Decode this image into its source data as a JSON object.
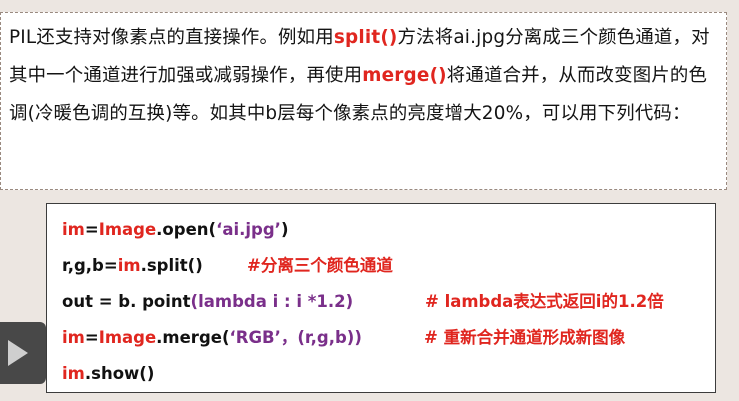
{
  "intro": {
    "text_1": "PIL还支持对像素点的直接操作。例如用",
    "kw_split": "split()",
    "text_2": "方法将ai.jpg分离成三个颜色通道，对其中一个通道进行加强或减弱操作，再使用",
    "kw_merge": "merge()",
    "text_3": "将通道合并，从而改变图片的色调(冷暖色调的互换)等。如其中b层每个像素点的亮度增大20%，可以用下列代码："
  },
  "code": {
    "line1": {
      "var": "im",
      "eq": "=",
      "obj": "Image",
      "method": ".open(",
      "arg": "‘ai.jpg’",
      "close": ")"
    },
    "line2": {
      "pre": "r,g,b=",
      "var": "im",
      "call": ".split()",
      "comment": "#分离三个颜色通道"
    },
    "line3": {
      "pre": "out = b. point",
      "args": "(lambda i : i *1.2)",
      "comment": "# lambda表达式返回i的1.2倍"
    },
    "line4": {
      "var": "im",
      "eq": "=",
      "obj": "Image",
      "method": ".merge(",
      "arg1": "‘RGB’",
      "rest": "，(r,g,b))",
      "comment": "# 重新合并通道形成新图像"
    },
    "line5": {
      "var": "im",
      "call": ".show()"
    }
  },
  "player": {
    "icon": "play-icon"
  },
  "colors": {
    "keyword": "#e0261f",
    "purple": "#7a2f8a",
    "background": "#ece6e1"
  }
}
